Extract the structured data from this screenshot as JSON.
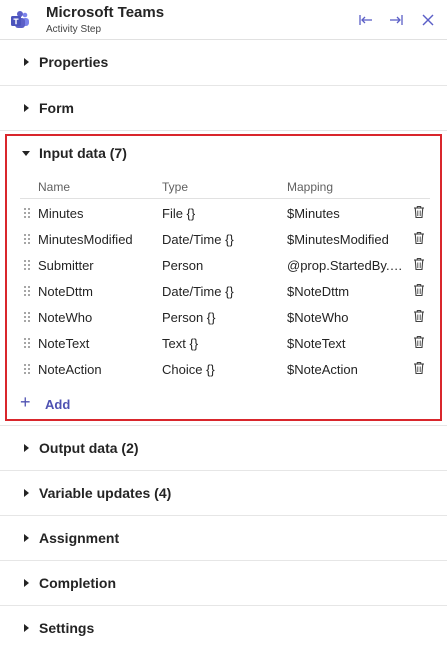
{
  "header": {
    "title": "Microsoft Teams",
    "subtitle": "Activity Step",
    "icons": [
      "teams-logo",
      "collapse-left-icon",
      "collapse-right-icon",
      "close-icon"
    ]
  },
  "sections": {
    "properties": "Properties",
    "form": "Form",
    "input_data": "Input data (7)",
    "output_data": "Output data (2)",
    "variable_updates": "Variable updates (4)",
    "assignment": "Assignment",
    "completion": "Completion",
    "settings": "Settings"
  },
  "input_table": {
    "columns": {
      "name": "Name",
      "type": "Type",
      "mapping": "Mapping"
    },
    "rows": [
      {
        "name": "Minutes",
        "type": "File {}",
        "mapping": "$Minutes"
      },
      {
        "name": "MinutesModified",
        "type": "Date/Time {}",
        "mapping": "$MinutesModified"
      },
      {
        "name": "Submitter",
        "type": "Person",
        "mapping": "@prop.StartedBy.P..."
      },
      {
        "name": "NoteDttm",
        "type": "Date/Time {}",
        "mapping": "$NoteDttm"
      },
      {
        "name": "NoteWho",
        "type": "Person {}",
        "mapping": "$NoteWho"
      },
      {
        "name": "NoteText",
        "type": "Text {}",
        "mapping": "$NoteText"
      },
      {
        "name": "NoteAction",
        "type": "Choice {}",
        "mapping": "$NoteAction"
      }
    ],
    "add_label": "Add"
  },
  "colors": {
    "highlight": "#d9262c",
    "accent": "#4f52b2",
    "teams": "#5b5fc7"
  }
}
